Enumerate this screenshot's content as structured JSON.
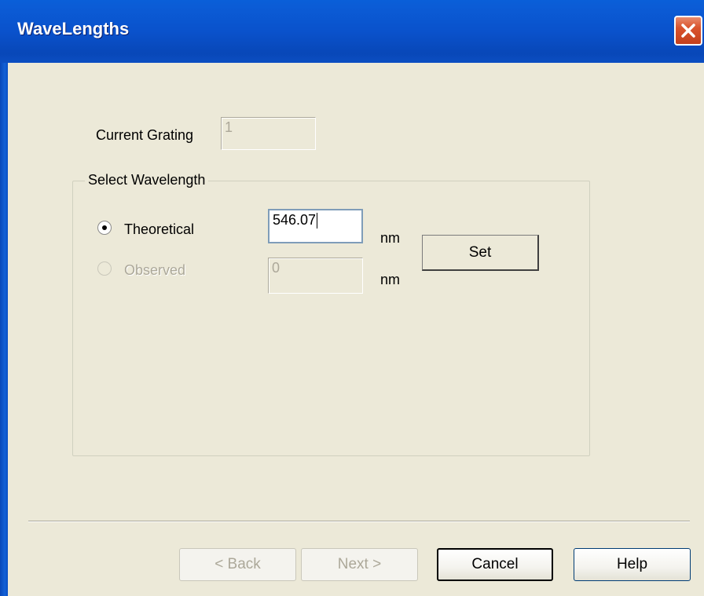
{
  "window": {
    "title": "WaveLengths"
  },
  "current_grating": {
    "label": "Current Grating",
    "value": "1"
  },
  "select_wavelength": {
    "group_title": "Select Wavelength",
    "theoretical": {
      "label": "Theoretical",
      "value": "546.07",
      "unit": "nm",
      "selected": true
    },
    "observed": {
      "label": "Observed",
      "value": "0",
      "unit": "nm",
      "selected": false,
      "enabled": false
    },
    "set_label": "Set"
  },
  "footer": {
    "back_label": "< Back",
    "next_label": "Next >",
    "cancel_label": "Cancel",
    "help_label": "Help"
  }
}
